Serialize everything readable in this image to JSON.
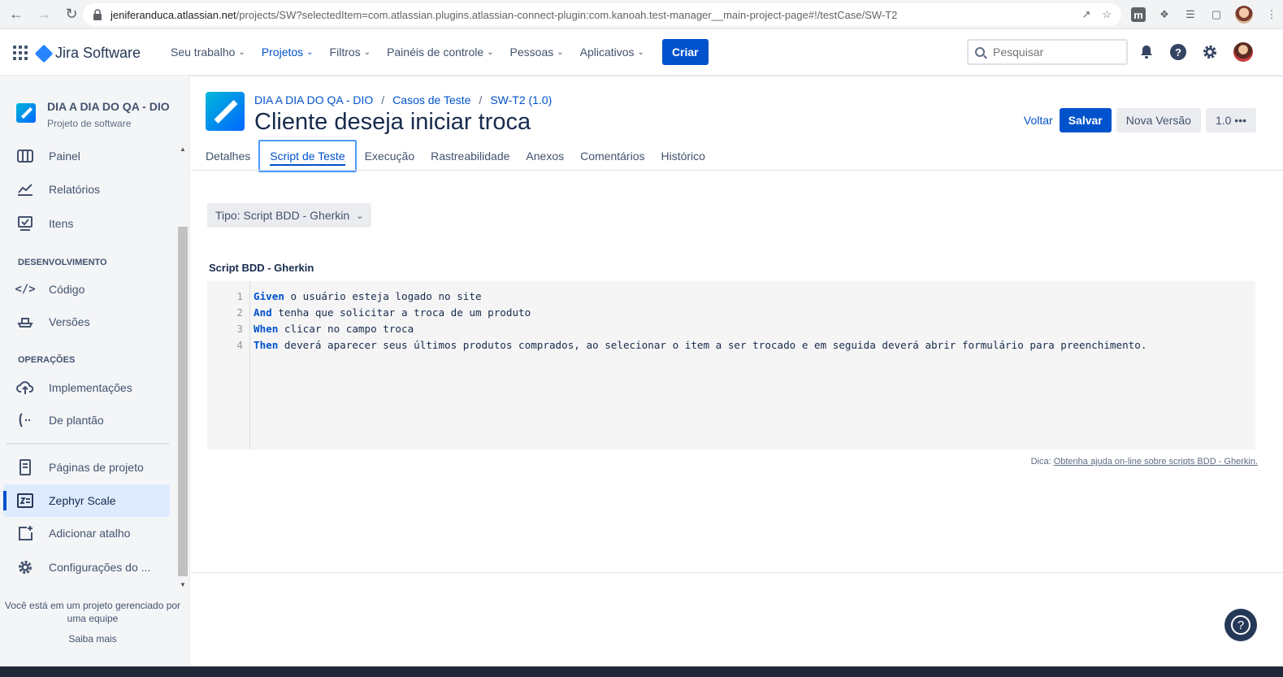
{
  "browser": {
    "url_host": "jeniferanduca.atlassian.net",
    "url_path": "/projects/SW?selectedItem=com.atlassian.plugins.atlassian-connect-plugin:com.kanoah.test-manager__main-project-page#!/testCase/SW-T2"
  },
  "topnav": {
    "product": "Jira Software",
    "items": [
      {
        "label": "Seu trabalho"
      },
      {
        "label": "Projetos"
      },
      {
        "label": "Filtros"
      },
      {
        "label": "Painéis de controle"
      },
      {
        "label": "Pessoas"
      },
      {
        "label": "Aplicativos"
      }
    ],
    "create_label": "Criar",
    "search_placeholder": "Pesquisar"
  },
  "sidebar": {
    "project_name": "DIA A DIA DO QA - DIO",
    "project_type": "Projeto de software",
    "items_top": [
      {
        "label": "Painel"
      },
      {
        "label": "Relatórios"
      },
      {
        "label": "Itens"
      }
    ],
    "section_dev": "DESENVOLVIMENTO",
    "items_dev": [
      {
        "label": "Código"
      },
      {
        "label": "Versões"
      }
    ],
    "section_ops": "OPERAÇÕES",
    "items_ops": [
      {
        "label": "Implementações"
      },
      {
        "label": "De plantão"
      }
    ],
    "items_bottom": [
      {
        "label": "Páginas de projeto"
      },
      {
        "label": "Zephyr Scale"
      },
      {
        "label": "Adicionar atalho"
      },
      {
        "label": "Configurações do ..."
      }
    ],
    "footer_text": "Você está em um projeto gerenciado por uma equipe",
    "footer_link": "Saiba mais"
  },
  "main": {
    "breadcrumbs": [
      "DIA A DIA DO QA - DIO",
      "Casos de Teste",
      "SW-T2 (1.0)"
    ],
    "title": "Cliente deseja iniciar troca",
    "actions": {
      "back": "Voltar",
      "save": "Salvar",
      "new_version": "Nova Versão",
      "version": "1.0 •••"
    },
    "tabs": [
      {
        "label": "Detalhes"
      },
      {
        "label": "Script de Teste"
      },
      {
        "label": "Execução"
      },
      {
        "label": "Rastreabilidade"
      },
      {
        "label": "Anexos"
      },
      {
        "label": "Comentários"
      },
      {
        "label": "Histórico"
      }
    ],
    "type_select": "Tipo: Script BDD - Gherkin",
    "script_label": "Script BDD - Gherkin",
    "script_lines": [
      {
        "num": "1",
        "keyword": "Given",
        "text": " o usuário esteja logado no site"
      },
      {
        "num": "2",
        "keyword": "And",
        "text": " tenha que solicitar a troca de um produto"
      },
      {
        "num": "3",
        "keyword": "When",
        "text": " clicar no campo troca"
      },
      {
        "num": "4",
        "keyword": "Then",
        "text": " deverá aparecer seus últimos produtos comprados, ao selecionar o item a ser trocado e em seguida deverá abrir formulário para preenchimento."
      }
    ],
    "tip_label": "Dica:",
    "tip_link": "Obtenha ajuda on-line sobre scripts BDD - Gherkin."
  },
  "colors": {
    "accent": "#0052cc",
    "sidebar_bg": "#f4f5f7",
    "selected_bg": "#deebff"
  }
}
